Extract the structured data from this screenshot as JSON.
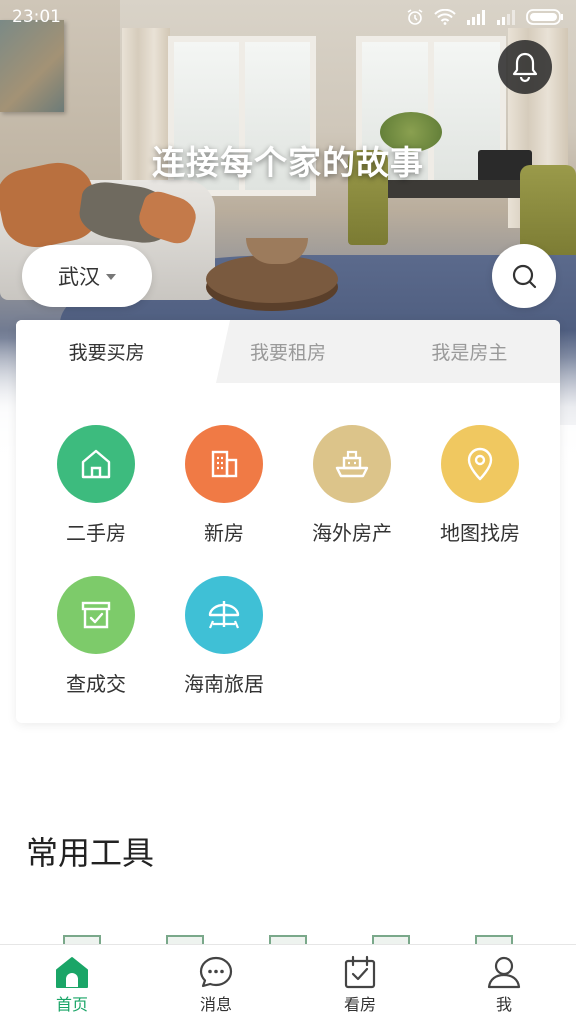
{
  "status_bar": {
    "time": "23:01",
    "icons": [
      "alarm-icon",
      "wifi-icon",
      "signal-icon",
      "signal-icon",
      "battery-icon"
    ]
  },
  "hero": {
    "slogan": "连接每个家的故事",
    "bell_icon": "bell-icon",
    "city": "武汉",
    "search_icon": "search-icon"
  },
  "card": {
    "tabs": [
      {
        "label": "我要买房",
        "active": true
      },
      {
        "label": "我要租房",
        "active": false
      },
      {
        "label": "我是房主",
        "active": false
      }
    ],
    "items": [
      {
        "label": "二手房",
        "icon": "house-icon",
        "color": "#3dbb7e"
      },
      {
        "label": "新房",
        "icon": "building-icon",
        "color": "#f07a45"
      },
      {
        "label": "海外房产",
        "icon": "ship-icon",
        "color": "#dcc48a"
      },
      {
        "label": "地图找房",
        "icon": "map-pin-icon",
        "color": "#f0c860"
      },
      {
        "label": "查成交",
        "icon": "archive-box-icon",
        "color": "#7dcb6a"
      },
      {
        "label": "海南旅居",
        "icon": "beach-umbrella-icon",
        "color": "#3fc0d6"
      }
    ]
  },
  "tools": {
    "title": "常用工具"
  },
  "bottom_nav": {
    "items": [
      {
        "label": "首页",
        "icon": "home-icon",
        "active": true
      },
      {
        "label": "消息",
        "icon": "chat-bubble-icon",
        "active": false
      },
      {
        "label": "看房",
        "icon": "calendar-check-icon",
        "active": false
      },
      {
        "label": "我",
        "icon": "user-icon",
        "active": false
      }
    ]
  },
  "colors": {
    "accent_green": "#1aa567",
    "inactive_tab_text": "#9a9a9a"
  }
}
